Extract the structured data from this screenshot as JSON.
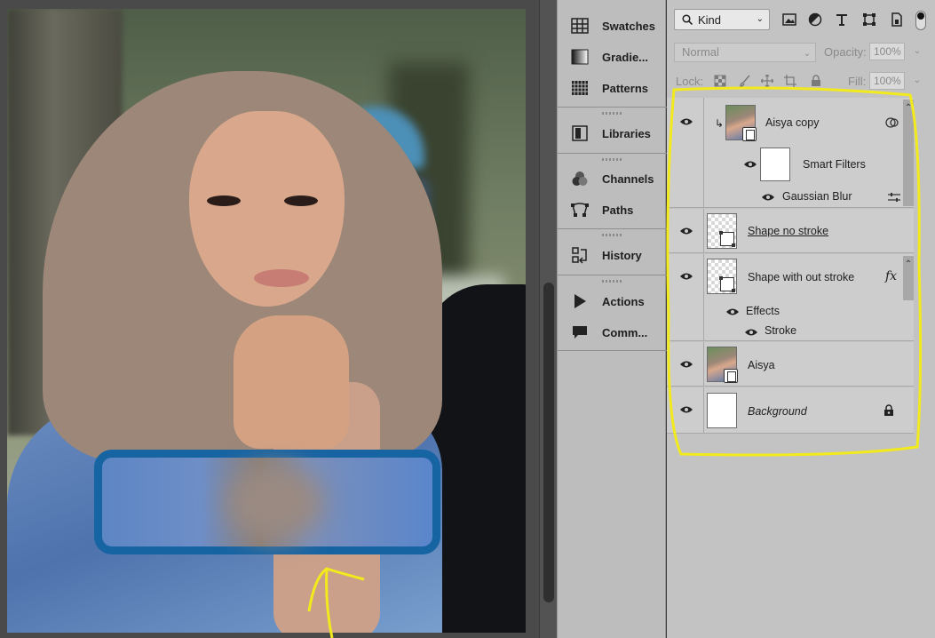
{
  "dock": {
    "items": [
      {
        "label": "Swatches",
        "icon": "swatches-icon"
      },
      {
        "label": "Gradie...",
        "icon": "gradients-icon"
      },
      {
        "label": "Patterns",
        "icon": "patterns-icon"
      },
      {
        "label": "Libraries",
        "icon": "libraries-icon"
      },
      {
        "label": "Channels",
        "icon": "channels-icon"
      },
      {
        "label": "Paths",
        "icon": "paths-icon"
      },
      {
        "label": "History",
        "icon": "history-icon"
      },
      {
        "label": "Actions",
        "icon": "actions-icon"
      },
      {
        "label": "Comm...",
        "icon": "comments-icon"
      }
    ]
  },
  "layers_panel": {
    "filter_kind": "Kind",
    "blend_mode": "Normal",
    "opacity_label": "Opacity:",
    "opacity_value": "100%",
    "lock_label": "Lock:",
    "fill_label": "Fill:",
    "fill_value": "100%",
    "layers": [
      {
        "name": "Aisya copy",
        "type": "smart-object",
        "visible": true,
        "clipped": true
      },
      {
        "name": "Smart Filters",
        "type": "smart-filters",
        "visible": true
      },
      {
        "name": "Gaussian Blur",
        "type": "filter",
        "visible": true
      },
      {
        "name": "Shape no stroke",
        "type": "shape",
        "visible": true
      },
      {
        "name": "Shape with out stroke",
        "type": "shape",
        "visible": true,
        "fx": "fx"
      },
      {
        "name": "Effects",
        "type": "effects",
        "visible": true
      },
      {
        "name": "Stroke",
        "type": "effect",
        "visible": true
      },
      {
        "name": "Aisya",
        "type": "smart-object",
        "visible": true
      },
      {
        "name": "Background",
        "type": "background",
        "visible": true,
        "locked": true
      }
    ]
  },
  "colors": {
    "annotation": "#f2ea1d",
    "blur_box_stroke": "#1764a3"
  }
}
